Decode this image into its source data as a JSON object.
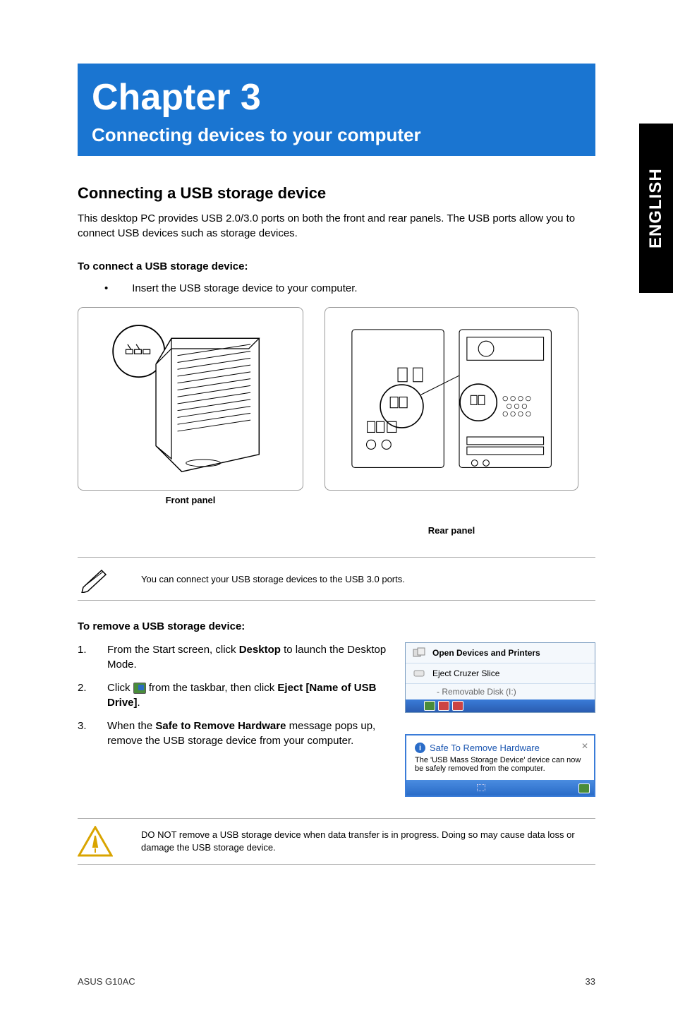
{
  "side_tab": "ENGLISH",
  "chapter": {
    "title": "Chapter 3",
    "subtitle": "Connecting devices to your computer"
  },
  "section_title": "Connecting a USB storage device",
  "intro_text": "This desktop PC provides USB 2.0/3.0 ports on both the front and rear panels. The USB ports allow you to connect USB devices such as storage devices.",
  "connect_heading": "To connect a USB storage device:",
  "connect_bullet": "Insert the USB storage device to your computer.",
  "front_panel_label": "Front panel",
  "rear_panel_label": "Rear panel",
  "note_text": "You can connect your USB storage devices to the USB 3.0 ports.",
  "remove_heading": "To remove a USB storage device:",
  "steps": [
    {
      "num": "1.",
      "pre": "From the Start screen, click ",
      "bold": "Desktop",
      "post": " to launch the Desktop Mode."
    },
    {
      "num": "2.",
      "pre": "Click ",
      "bold_mid": " from the taskbar, then click ",
      "bold2": "Eject [Name of USB Drive]",
      "post2": "."
    },
    {
      "num": "3.",
      "pre": "When the ",
      "bold": "Safe to Remove Hardware",
      "post": " message pops up, remove the USB storage device from your computer."
    }
  ],
  "popup1": {
    "row1": "Open Devices and Printers",
    "row2": "Eject Cruzer Slice",
    "row3": "-  Removable Disk (I:)"
  },
  "popup2": {
    "title": "Safe To Remove Hardware",
    "body": "The 'USB Mass Storage Device' device can now be safely removed from the computer."
  },
  "warning_text": "DO NOT remove a USB storage device when data transfer is in progress. Doing so may cause data loss or damage the USB storage device.",
  "footer": {
    "left": "ASUS G10AC",
    "right": "33"
  }
}
